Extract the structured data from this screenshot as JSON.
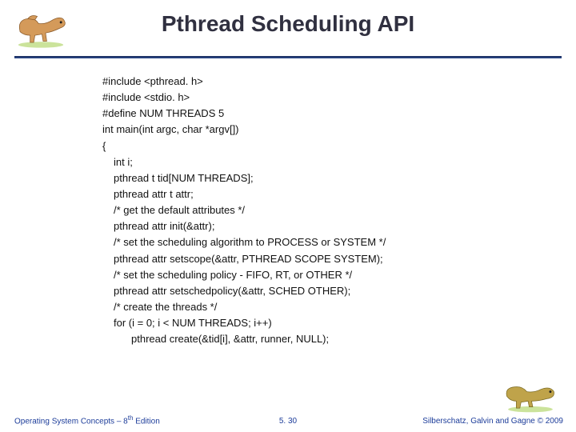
{
  "slide": {
    "title": "Pthread Scheduling API",
    "code_lines": [
      {
        "text": "#include <pthread. h>",
        "indent": 0
      },
      {
        "text": "#include <stdio. h>",
        "indent": 0
      },
      {
        "text": "#define NUM THREADS 5",
        "indent": 0
      },
      {
        "text": "int main(int argc, char *argv[])",
        "indent": 0
      },
      {
        "text": "{",
        "indent": 0
      },
      {
        "text": " int i;",
        "indent": 1
      },
      {
        "text": "pthread t tid[NUM THREADS];",
        "indent": 1
      },
      {
        "text": "pthread attr t attr;",
        "indent": 1
      },
      {
        "text": "/* get the default attributes */",
        "indent": 1
      },
      {
        "text": "pthread attr init(&attr);",
        "indent": 1
      },
      {
        "text": "/* set the scheduling algorithm to PROCESS or SYSTEM */",
        "indent": 1
      },
      {
        "text": "pthread attr setscope(&attr, PTHREAD SCOPE SYSTEM);",
        "indent": 1
      },
      {
        "text": "/* set the scheduling policy - FIFO, RT, or OTHER */",
        "indent": 1
      },
      {
        "text": "pthread attr setschedpolicy(&attr, SCHED OTHER);",
        "indent": 1
      },
      {
        "text": "/* create the threads */",
        "indent": 1
      },
      {
        "text": "for (i = 0; i < NUM THREADS; i++)",
        "indent": 1
      },
      {
        "text": "pthread create(&tid[i], &attr, runner, NULL);",
        "indent": 2
      }
    ],
    "footer": {
      "left_pre": "Operating System Concepts – 8",
      "left_sup": "th",
      "left_post": " Edition",
      "center": "5. 30",
      "right": "Silberschatz, Galvin and Gagne © 2009"
    },
    "icons": {
      "top_dino": "dinosaur-running-icon",
      "bottom_dino": "dinosaur-grazing-icon"
    }
  }
}
